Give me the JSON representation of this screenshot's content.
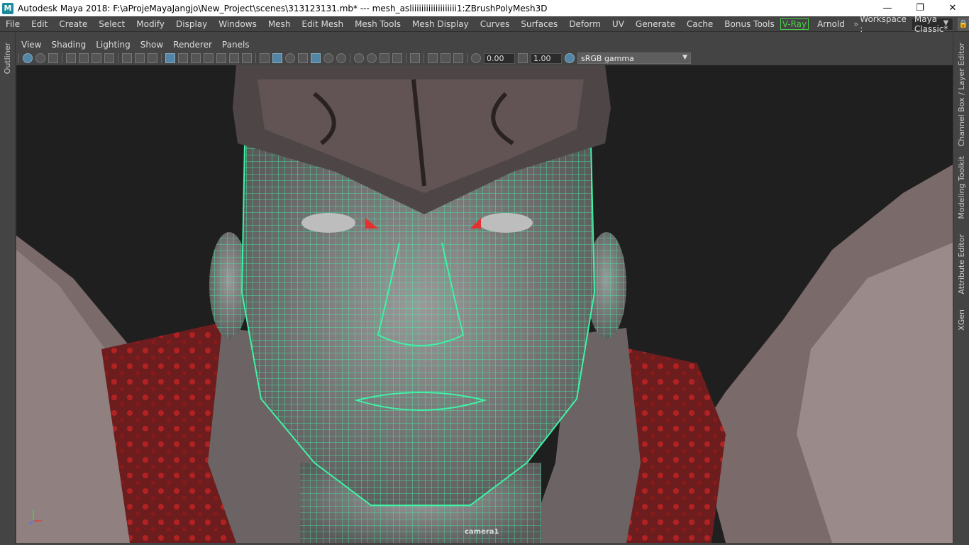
{
  "window": {
    "app_logo": "M",
    "title": "Autodesk Maya 2018: F:\\aProjeMayaJangjo\\New_Project\\scenes\\313123131.mb*   ---   mesh_asliiiiiiiiiiiiiiiiiii1:ZBrushPolyMesh3D",
    "minimize": "—",
    "restore": "❐",
    "close": "✕"
  },
  "menu": {
    "items": [
      "File",
      "Edit",
      "Create",
      "Select",
      "Modify",
      "Display",
      "Windows",
      "Mesh",
      "Edit Mesh",
      "Mesh Tools",
      "Mesh Display",
      "Curves",
      "Surfaces",
      "Deform",
      "UV",
      "Generate",
      "Cache",
      "Bonus Tools"
    ],
    "vray": "V-Ray",
    "arnold": "Arnold",
    "chevron": "»",
    "workspace_label": "Workspace :",
    "workspace_value": "Maya Classic*",
    "lock_icon": "lock-icon"
  },
  "side_tabs": {
    "left": [
      "Outliner"
    ],
    "right": [
      "Channel Box / Layer Editor",
      "Modeling Toolkit",
      "Attribute Editor",
      "XGen"
    ]
  },
  "panel": {
    "menu": [
      "View",
      "Shading",
      "Lighting",
      "Show",
      "Renderer",
      "Panels"
    ],
    "exposure": "0.00",
    "gamma": "1.00",
    "color_space": "sRGB gamma"
  },
  "viewport": {
    "camera_label": "camera1",
    "wire_color": "#3ff2a6",
    "background": "#1f1f1f"
  }
}
